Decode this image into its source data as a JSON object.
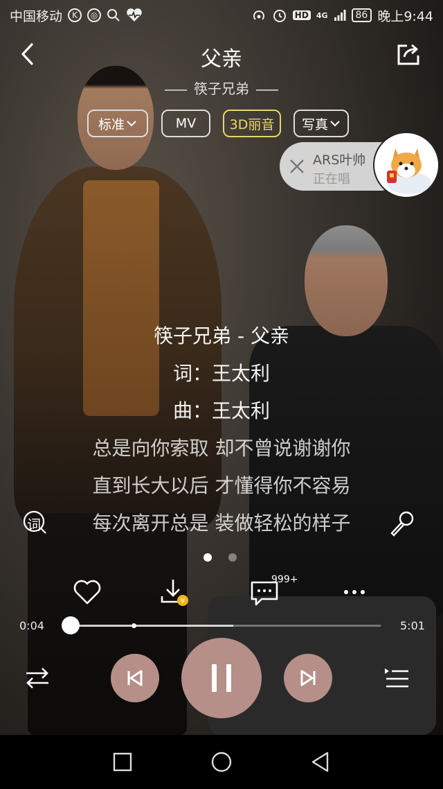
{
  "status_bar": {
    "carrier": "中国移动",
    "time": "晚上9:44",
    "battery": "86",
    "network": "4G",
    "hd": "HD",
    "left_icons": [
      "k-icon",
      "weibo-icon",
      "search-icon",
      "heart-rate-icon"
    ],
    "right_icons": [
      "hotspot-icon",
      "alarm-icon"
    ]
  },
  "header": {
    "title": "父亲",
    "artist": "筷子兄弟"
  },
  "quality_tabs": [
    {
      "label": "标准",
      "has_dropdown": true
    },
    {
      "label": "MV",
      "has_dropdown": false
    },
    {
      "label": "3D丽音",
      "has_dropdown": false,
      "color": "#ecd96f"
    },
    {
      "label": "写真",
      "has_dropdown": true
    }
  ],
  "singing_card": {
    "name": "ARS叶帅",
    "status": "正在唱"
  },
  "lyrics": {
    "lines": [
      "筷子兄弟 - 父亲",
      "词：王太利",
      "曲：王太利",
      "总是向你索取 却不曾说谢谢你",
      "直到长大以后 才懂得你不容易",
      "每次离开总是 装做轻松的样子"
    ],
    "lyric_button": "词"
  },
  "page_indicator": {
    "count": 2,
    "active_index": 0
  },
  "actions": {
    "comment_count": "999+"
  },
  "progress": {
    "current": "0:04",
    "total": "5:01",
    "played_fraction": 0.013,
    "buffered_fraction": 0.53
  },
  "colors": {
    "control_accent": "#b58f88",
    "gold_tab": "#ecd96f",
    "download_badge": "#f2b517"
  }
}
